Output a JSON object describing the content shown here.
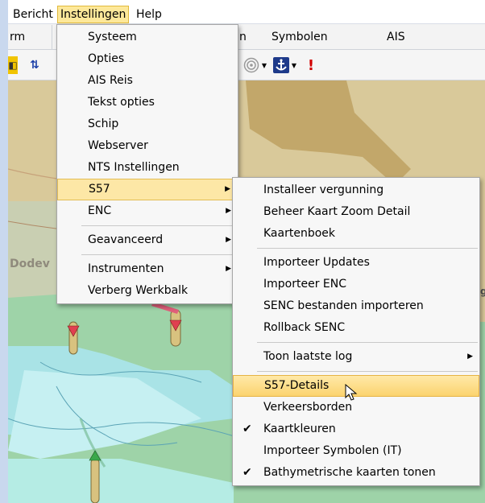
{
  "menubar": {
    "items": [
      {
        "label": "Bericht"
      },
      {
        "label": "Instellingen"
      },
      {
        "label": "Help"
      }
    ]
  },
  "tabs": [
    {
      "label": "rm"
    },
    {
      "label": "n"
    },
    {
      "label": "Symbolen"
    },
    {
      "label": "AIS"
    }
  ],
  "map": {
    "label": "Dodev",
    "label2": "g"
  },
  "instellingen_menu": {
    "items": [
      {
        "label": "Systeem"
      },
      {
        "label": "Opties"
      },
      {
        "label": "AIS Reis"
      },
      {
        "label": "Tekst opties"
      },
      {
        "label": "Schip"
      },
      {
        "label": "Webserver"
      },
      {
        "label": "NTS Instellingen"
      },
      {
        "label": "S57"
      },
      {
        "label": "ENC"
      },
      {
        "label": "Geavanceerd"
      },
      {
        "label": "Instrumenten"
      },
      {
        "label": "Verberg Werkbalk"
      }
    ]
  },
  "s57_menu": {
    "items": [
      {
        "label": "Installeer vergunning"
      },
      {
        "label": "Beheer Kaart Zoom Detail"
      },
      {
        "label": "Kaartenboek"
      },
      {
        "label": "Importeer Updates"
      },
      {
        "label": "Importeer ENC"
      },
      {
        "label": "SENC bestanden importeren"
      },
      {
        "label": "Rollback SENC"
      },
      {
        "label": "Toon laatste log"
      },
      {
        "label": "S57-Details"
      },
      {
        "label": "Verkeersborden"
      },
      {
        "label": "Kaartkleuren"
      },
      {
        "label": "Importeer Symbolen (IT)"
      },
      {
        "label": "Bathymetrische kaarten tonen"
      }
    ]
  }
}
